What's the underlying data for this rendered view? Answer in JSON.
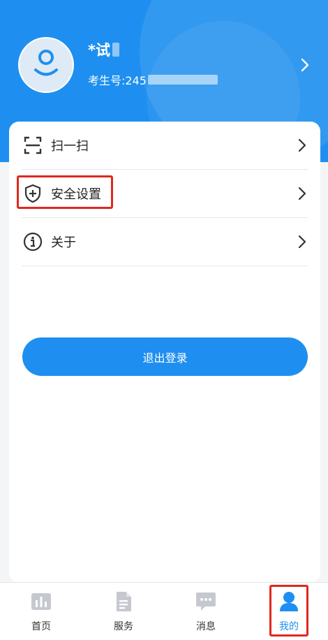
{
  "profile": {
    "name": "*试",
    "id_label": "考生号:245"
  },
  "menu": [
    {
      "label": "扫一扫",
      "icon": "scan-icon"
    },
    {
      "label": "安全设置",
      "icon": "shield-plus-icon"
    },
    {
      "label": "关于",
      "icon": "info-icon"
    }
  ],
  "logout_label": "退出登录",
  "tabs": [
    {
      "label": "首页",
      "icon": "chart-icon"
    },
    {
      "label": "服务",
      "icon": "document-icon"
    },
    {
      "label": "消息",
      "icon": "message-icon"
    },
    {
      "label": "我的",
      "icon": "user-icon"
    }
  ],
  "colors": {
    "primary": "#1e8ff0",
    "highlight": "#e0281f",
    "tab_inactive_icon": "#c5c9cf"
  }
}
